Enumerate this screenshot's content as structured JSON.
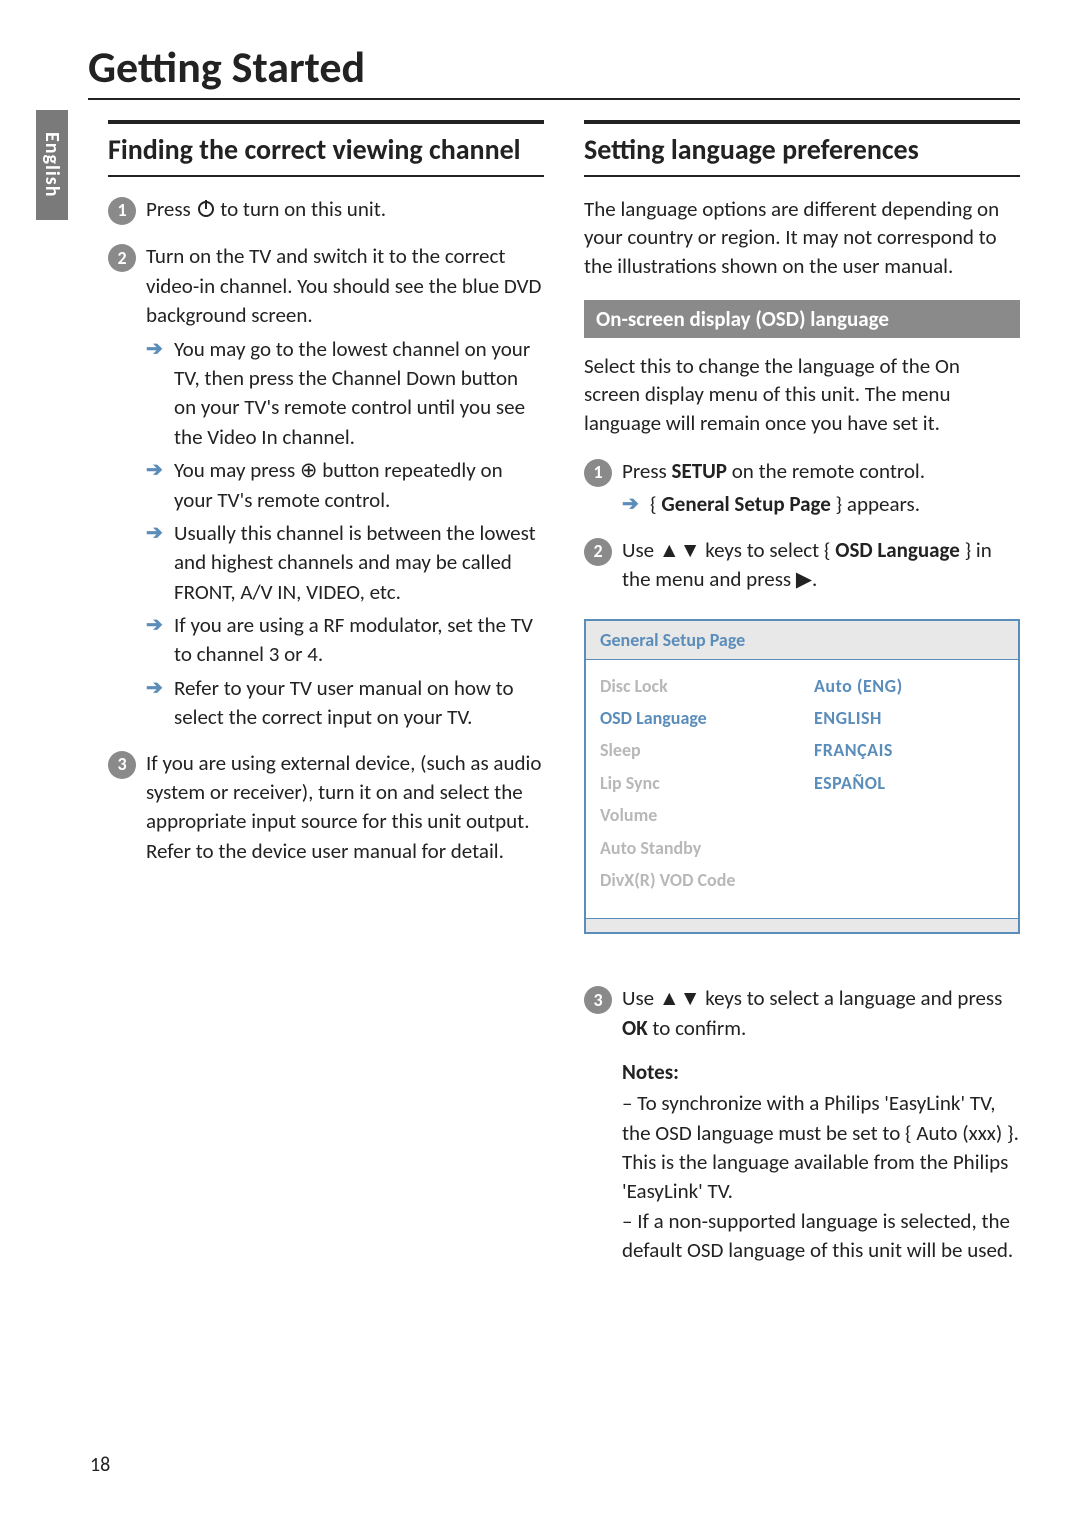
{
  "page_number": "18",
  "lang_tab": "English",
  "title": "Getting Started",
  "left": {
    "heading": "Finding the correct viewing channel",
    "steps": [
      {
        "num": "1",
        "text_pre": "Press ",
        "text_post": " to turn on this unit.",
        "icon": "power"
      },
      {
        "num": "2",
        "text": "Turn on the TV and switch it to the correct video-in channel. You should see the blue DVD background screen.",
        "subs": [
          "You may go to the lowest channel on your TV, then press the Channel Down button on your TV's remote control until you see the Video In channel.",
          "You may press ⊕ button repeatedly on your TV's remote control.",
          "Usually this channel is between the lowest and highest channels and may be called FRONT, A/V IN, VIDEO, etc.",
          "If you are using a RF modulator, set the TV to channel 3 or 4.",
          "Refer to your TV user manual on how to select the correct input on your TV."
        ]
      },
      {
        "num": "3",
        "text": "If you are using external device, (such as audio system or receiver), turn it on and select the appropriate input source for this unit output. Refer to the device user manual for detail."
      }
    ]
  },
  "right": {
    "heading": "Setting language preferences",
    "intro": "The language options are different depending on your country or region. It may not correspond to the illustrations shown on the user manual.",
    "osd_band": "On-screen display (OSD) language",
    "osd_intro": "Select this to change the language of the On screen display menu of this unit. The menu language will remain once you have set it.",
    "steps": [
      {
        "num": "1",
        "parts": {
          "a": "Press ",
          "b": "SETUP",
          "c": " on the remote control."
        },
        "sub": {
          "a": "{ ",
          "b": "General Setup Page",
          "c": " } appears."
        }
      },
      {
        "num": "2",
        "parts": {
          "a": "Use ",
          "b_up": "▲",
          "b_dn": "▼",
          "c": " keys to select { ",
          "d": "OSD Language",
          "e": " } in the menu and press ",
          "f": "▶",
          "g": "."
        }
      },
      {
        "num": "3",
        "parts": {
          "a": "Use ",
          "b_up": "▲",
          "b_dn": "▼",
          "c": " keys to select a language and press ",
          "d": "OK",
          "e": " to confirm."
        }
      }
    ],
    "osd_panel": {
      "header": "General Setup Page",
      "left_items": [
        "Disc Lock",
        "OSD Language",
        "Sleep",
        "Lip Sync",
        "Volume",
        "Auto Standby",
        "DivX(R) VOD Code"
      ],
      "selected_index": 1,
      "right_items": [
        "Auto (ENG)",
        "ENGLISH",
        "FRANÇAIS",
        "ESPAÑOL"
      ]
    },
    "notes_head": "Notes:",
    "notes": [
      "–  To synchronize with a Philips 'EasyLink' TV, the OSD language must be set to { Auto (xxx) }. This is the language available from the Philips 'EasyLink' TV.",
      "–  If a non-supported language is selected, the default OSD language of this unit will be used."
    ]
  }
}
